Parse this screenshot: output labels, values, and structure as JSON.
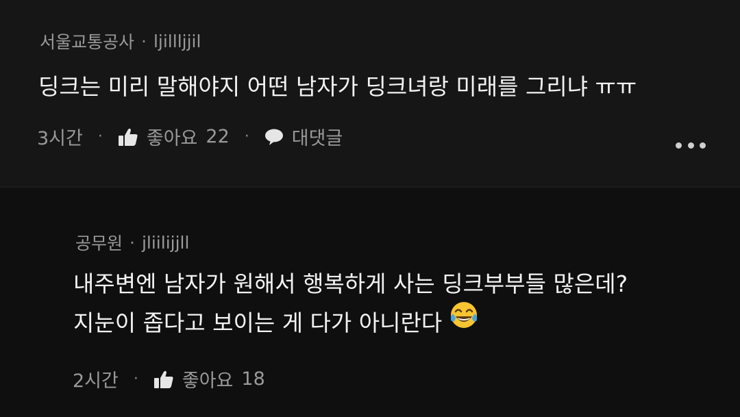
{
  "comments": [
    {
      "author": "서울교통공사",
      "handle": "ljillljjil",
      "lines": [
        "딩크는 미리 말해야지 어떤 남자가 딩크녀랑 미래를 그리냐 ㅠㅠ"
      ],
      "time": "3시간",
      "like_label": "좋아요",
      "like_count": "22",
      "reply_label": "대댓글",
      "icons": {
        "like": "thumbs-up-icon",
        "reply": "chat-bubble-icon",
        "more": "more-options-icon"
      }
    },
    {
      "author": "공무원",
      "handle": "jliilijjll",
      "lines": [
        "내주변엔 남자가 원해서 행복하게 사는 딩크부부들 많은데?",
        "지눈이 좁다고 보이는 게 다가 아니란다"
      ],
      "time": "2시간",
      "like_label": "좋아요",
      "like_count": "18",
      "icons": {
        "like": "thumbs-up-icon",
        "emoji": "tears-of-joy-emoji"
      }
    }
  ],
  "separator_dot": "·",
  "colors": {
    "background": "#111111",
    "card": "#161616",
    "meta_text": "#9a9a9a",
    "body_text": "#f3f3f3",
    "emoji": "#f7c531"
  }
}
